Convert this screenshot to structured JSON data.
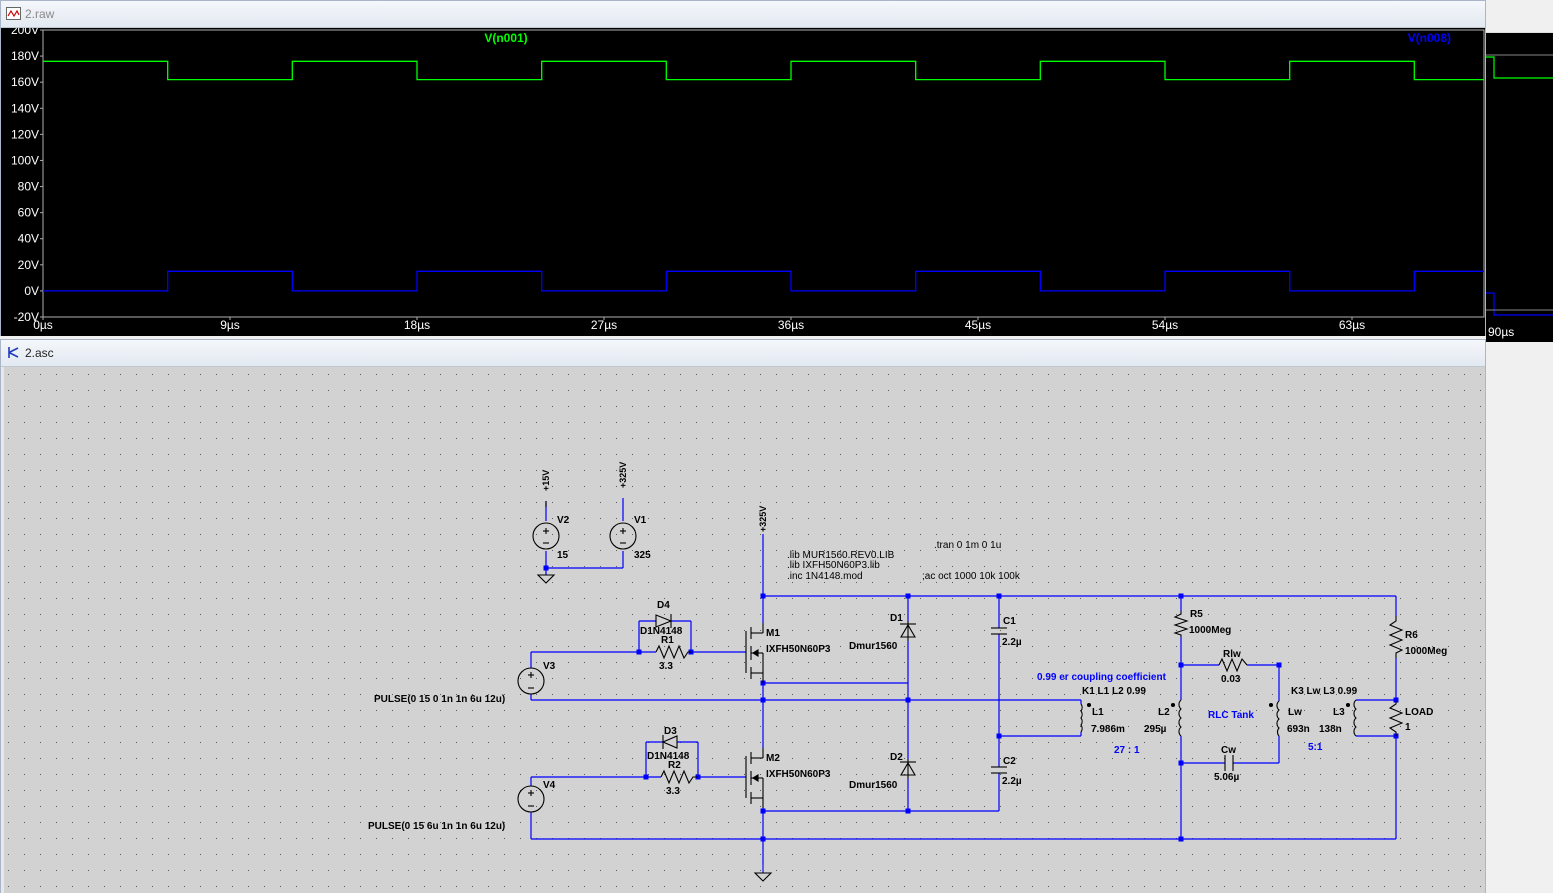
{
  "plot_window": {
    "title": "2.raw",
    "traces": [
      {
        "name": "V(n001)",
        "color": "#00ff00",
        "high": 176,
        "low": 162
      },
      {
        "name": "V(n008)",
        "color": "#0000ff",
        "high": 15,
        "low": 0
      }
    ],
    "y_ticks": [
      "200V",
      "180V",
      "160V",
      "140V",
      "120V",
      "100V",
      "80V",
      "60V",
      "40V",
      "20V",
      "0V",
      "-20V"
    ],
    "x_ticks": [
      "0µs",
      "9µs",
      "18µs",
      "27µs",
      "36µs",
      "45µs",
      "54µs",
      "63µs"
    ],
    "x_tick_peek": "90µs",
    "period_us": 12,
    "on_time_us": 6
  },
  "schematic_window": {
    "title": "2.asc",
    "labels": {
      "v2_name": "V2",
      "v2_val": "15",
      "v2_flag": "+15V",
      "v1_name": "V1",
      "v1_val": "325",
      "v1_flag": "+325V",
      "m_flag": "+325V",
      "d4_name": "D4",
      "d4_model": "D1N4148",
      "r1_name": "R1",
      "r1_val": "3.3",
      "m1_name": "M1",
      "m1_model": "IXFH50N60P3",
      "v3_name": "V3",
      "v3_val": "PULSE(0 15 0 1n 1n 6u 12u)",
      "d3_name": "D3",
      "d3_model": "D1N4148",
      "r2_name": "R2",
      "r2_val": "3.3",
      "m2_name": "M2",
      "m2_model": "IXFH50N60P3",
      "v4_name": "V4",
      "v4_val": "PULSE(0 15 6u 1n 1n 6u 12u)",
      "d1_name": "D1",
      "d1_model": "Dmur1560",
      "d2_name": "D2",
      "d2_model": "Dmur1560",
      "c1_name": "C1",
      "c1_val": "2.2µ",
      "c2_name": "C2",
      "c2_val": "2.2µ",
      "lib1": ".lib MUR1560.REV0.LIB",
      "lib2": ".lib IXFH50N60P3.lib",
      "inc1": ".inc 1N4148.mod",
      "tran": ".tran 0 1m 0 1u",
      "ac": ";ac oct 1000 10k 100k",
      "r5_name": "R5",
      "r5_val": "1000Meg",
      "r6_name": "R6",
      "r6_val": "1000Meg",
      "rlw_name": "Rlw",
      "rlw_val": "0.03",
      "coupling_note": "0.99 er coupling coefficient",
      "k1": "K1 L1 L2 0.99",
      "k3": "K3 Lw L3 0.99",
      "l1_name": "L1",
      "l1_val": "7.986m",
      "l2_name": "L2",
      "l2_val": "295µ",
      "ratio1": "27 : 1",
      "tank": "RLC Tank",
      "lw_name": "Lw",
      "lw_val": "693n",
      "l3_name": "L3",
      "l3_val": "138n",
      "ratio2": "5:1",
      "load_name": "LOAD",
      "load_val": "1",
      "cw_name": "Cw",
      "cw_val": "5.06µ"
    }
  }
}
